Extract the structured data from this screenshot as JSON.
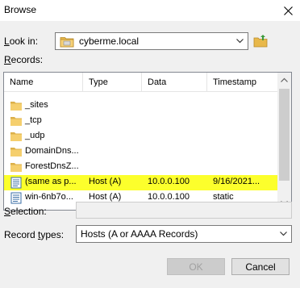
{
  "window": {
    "title": "Browse"
  },
  "look_in": {
    "label_pre": "",
    "label_hotkey": "L",
    "label_post": "ook in:",
    "value": "cyberme.local"
  },
  "records": {
    "label_pre": "",
    "label_hotkey": "R",
    "label_post": "ecords:",
    "columns": [
      "Name",
      "Type",
      "Data",
      "Timestamp"
    ],
    "rows": [
      {
        "icon": "folder-icon",
        "name": "_sites",
        "type": "",
        "data": "",
        "timestamp": ""
      },
      {
        "icon": "folder-icon",
        "name": "_tcp",
        "type": "",
        "data": "",
        "timestamp": ""
      },
      {
        "icon": "folder-icon",
        "name": "_udp",
        "type": "",
        "data": "",
        "timestamp": ""
      },
      {
        "icon": "folder-icon",
        "name": "DomainDns...",
        "type": "",
        "data": "",
        "timestamp": ""
      },
      {
        "icon": "folder-icon",
        "name": "ForestDnsZ...",
        "type": "",
        "data": "",
        "timestamp": ""
      },
      {
        "icon": "record-icon",
        "name": "(same as p...",
        "type": "Host (A)",
        "data": "10.0.0.100",
        "timestamp": "9/16/2021..."
      },
      {
        "icon": "record-icon",
        "name": "win-6nb7o...",
        "type": "Host (A)",
        "data": "10.0.0.100",
        "timestamp": "static"
      }
    ],
    "highlighted_row_index": 6,
    "highlight_color": "#fcff2c"
  },
  "selection": {
    "label_pre": "",
    "label_hotkey": "S",
    "label_post": "election:",
    "value": ""
  },
  "record_types": {
    "label_pre": "Record ",
    "label_hotkey": "t",
    "label_post": "ypes:",
    "value": "Hosts (A or AAAA Records)"
  },
  "buttons": {
    "ok": "OK",
    "cancel": "Cancel"
  }
}
